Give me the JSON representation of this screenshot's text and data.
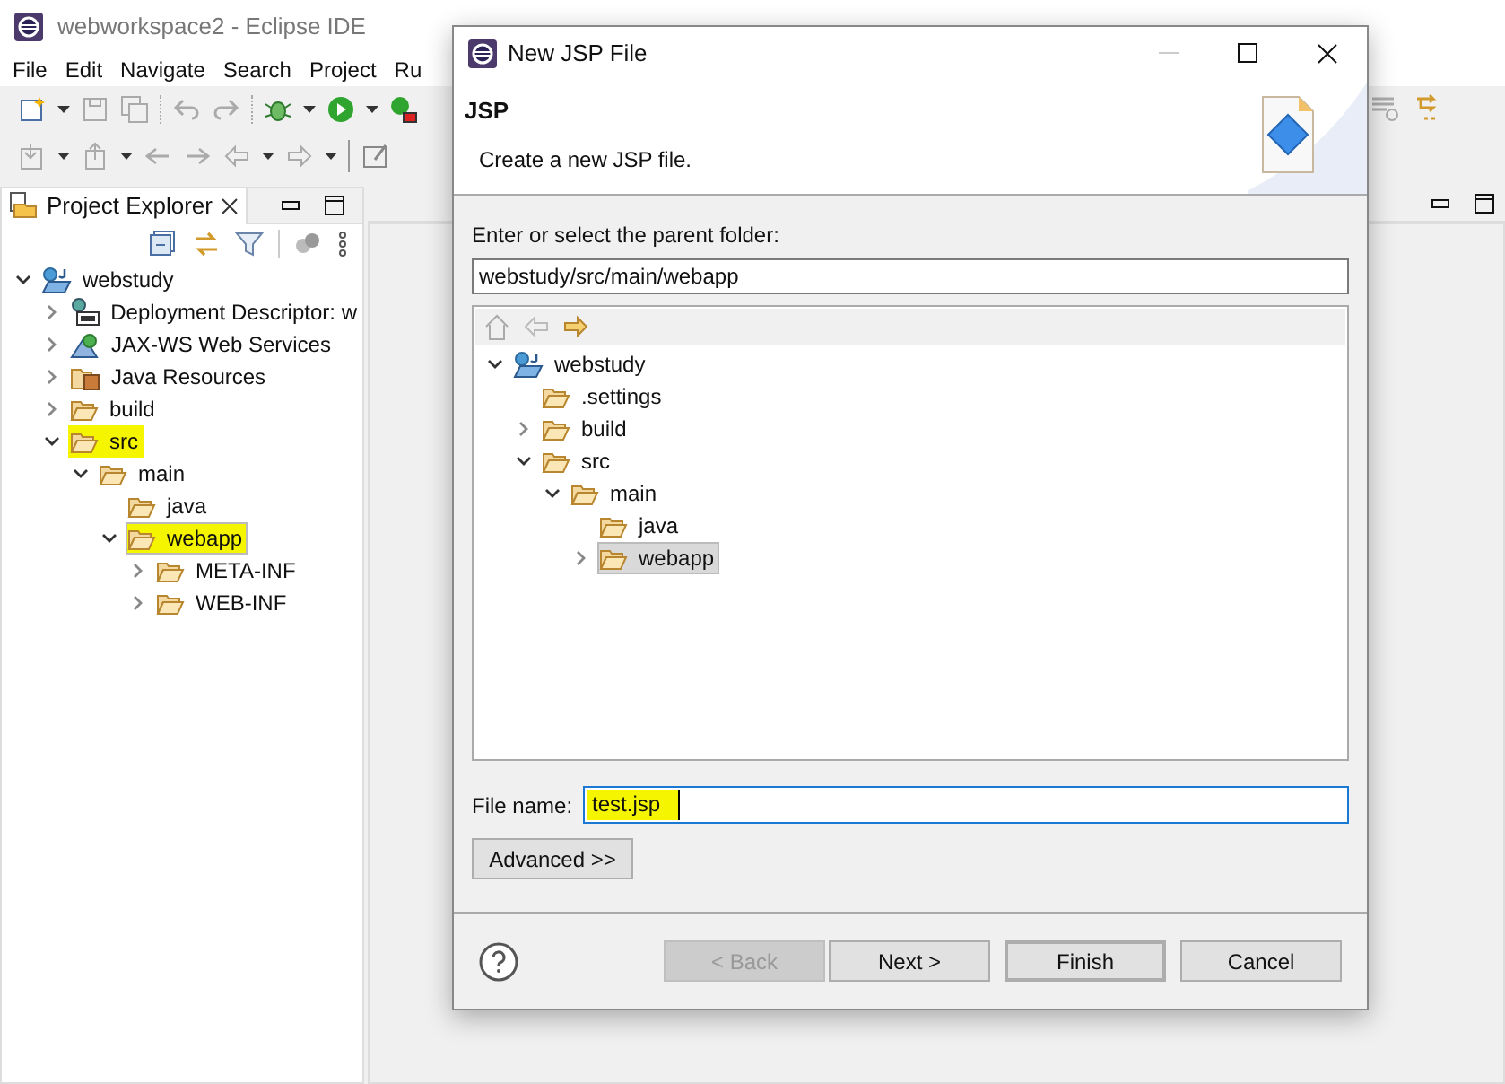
{
  "window": {
    "title": "webworkspace2 - Eclipse IDE"
  },
  "menu": [
    "File",
    "Edit",
    "Navigate",
    "Search",
    "Project",
    "Ru"
  ],
  "explorer": {
    "tab_label": "Project Explorer",
    "tree": [
      {
        "label": "webstudy",
        "kind": "project",
        "expanded": true,
        "highlighted": false,
        "selected": false,
        "children": [
          {
            "label": "Deployment Descriptor: w",
            "kind": "descriptor",
            "expanded": false,
            "highlighted": false,
            "selected": false
          },
          {
            "label": "JAX-WS Web Services",
            "kind": "webservices",
            "expanded": false,
            "highlighted": false,
            "selected": false
          },
          {
            "label": "Java Resources",
            "kind": "resources",
            "expanded": false,
            "highlighted": false,
            "selected": false
          },
          {
            "label": "build",
            "kind": "folder",
            "expanded": false,
            "highlighted": false,
            "selected": false
          },
          {
            "label": "src",
            "kind": "folder",
            "expanded": true,
            "highlighted": true,
            "selected": false,
            "children": [
              {
                "label": "main",
                "kind": "folder",
                "expanded": true,
                "highlighted": false,
                "selected": false,
                "children": [
                  {
                    "label": "java",
                    "kind": "folder",
                    "highlighted": false,
                    "selected": false
                  },
                  {
                    "label": "webapp",
                    "kind": "folder",
                    "expanded": true,
                    "highlighted": true,
                    "selected": true,
                    "children": [
                      {
                        "label": "META-INF",
                        "kind": "folder",
                        "expanded": false,
                        "highlighted": false,
                        "selected": false
                      },
                      {
                        "label": "WEB-INF",
                        "kind": "folder",
                        "expanded": false,
                        "highlighted": false,
                        "selected": false
                      }
                    ]
                  }
                ]
              }
            ]
          }
        ]
      }
    ]
  },
  "dialog": {
    "title": "New JSP File",
    "heading": "JSP",
    "description": "Create a new JSP file.",
    "parent_label": "Enter or select the parent folder:",
    "parent_value": "webstudy/src/main/webapp",
    "tree": [
      {
        "label": "webstudy",
        "kind": "project",
        "expanded": true,
        "highlighted": false,
        "selected": false,
        "children": [
          {
            "label": ".settings",
            "kind": "folder",
            "highlighted": false,
            "selected": false
          },
          {
            "label": "build",
            "kind": "folder",
            "expanded": false,
            "highlighted": false,
            "selected": false
          },
          {
            "label": "src",
            "kind": "folder",
            "expanded": true,
            "highlighted": false,
            "selected": false,
            "children": [
              {
                "label": "main",
                "kind": "folder",
                "expanded": true,
                "highlighted": false,
                "selected": false,
                "children": [
                  {
                    "label": "java",
                    "kind": "folder",
                    "highlighted": false,
                    "selected": false
                  },
                  {
                    "label": "webapp",
                    "kind": "folder",
                    "expanded": false,
                    "highlighted": false,
                    "selected": true
                  }
                ]
              }
            ]
          }
        ]
      }
    ],
    "file_label": "File name:",
    "file_value": "test.jsp",
    "file_value_highlighted": true,
    "advanced_button": "Advanced >>",
    "buttons": [
      {
        "label": "< Back",
        "disabled": true,
        "default": false
      },
      {
        "label": "Next >",
        "disabled": false,
        "default": false
      },
      {
        "label": "Finish",
        "disabled": false,
        "default": true
      },
      {
        "label": "Cancel",
        "disabled": false,
        "default": false
      }
    ]
  }
}
